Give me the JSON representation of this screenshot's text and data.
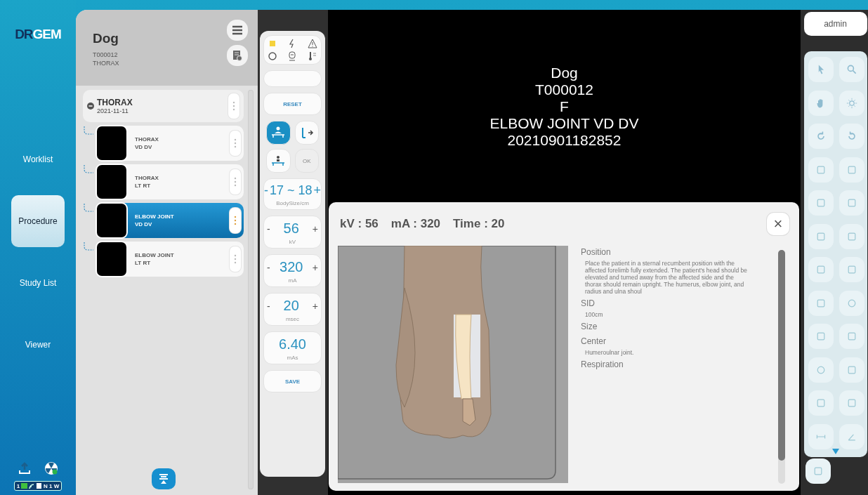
{
  "logo": {
    "parts": [
      "DR",
      "GEM"
    ]
  },
  "nav": [
    {
      "label": "Worklist",
      "selected": false
    },
    {
      "label": "Procedure",
      "selected": true
    },
    {
      "label": "Study List",
      "selected": false
    },
    {
      "label": "Viewer",
      "selected": false
    }
  ],
  "status": {
    "slot": "1",
    "mode": "N 1 W"
  },
  "patient": {
    "name": "Dog",
    "id": "T000012",
    "study": "THORAX"
  },
  "study_group": {
    "title": "THORAX",
    "date": "2021-11-11",
    "expanded": true
  },
  "procedures": [
    {
      "lines": [
        "THORAX",
        "VD DV"
      ],
      "selected": false
    },
    {
      "lines": [
        "THORAX",
        "LT RT"
      ],
      "selected": false
    },
    {
      "lines": [
        "ELBOW JOINT",
        "VD DV"
      ],
      "selected": true
    },
    {
      "lines": [
        "ELBOW JOINT",
        "LT RT"
      ],
      "selected": false
    }
  ],
  "controls": {
    "reset": "RESET",
    "positions": [
      {
        "kind": "supine",
        "selected": true,
        "disabled": false
      },
      {
        "kind": "lateral",
        "selected": false,
        "disabled": false
      },
      {
        "kind": "table",
        "selected": false,
        "disabled": false
      },
      {
        "kind": "text",
        "label": "OK",
        "selected": false,
        "disabled": true
      }
    ],
    "body_size": {
      "minus": "-",
      "value": "17 ~ 18",
      "plus": "+",
      "unit": "BodySize/cm"
    },
    "params": [
      {
        "value": "56",
        "unit": "kV",
        "minus": "-",
        "plus": "+"
      },
      {
        "value": "320",
        "unit": "mA",
        "minus": "-",
        "plus": "+"
      },
      {
        "value": "20",
        "unit": "msec",
        "minus": "-",
        "plus": "+"
      }
    ],
    "mas": {
      "value": "6.40",
      "unit": "mAs"
    },
    "save": "SAVE"
  },
  "viewer": {
    "lines": [
      "Dog",
      "T000012",
      "F",
      "ELBOW JOINT VD DV",
      "20210901182852"
    ]
  },
  "user": "admin",
  "dialog": {
    "readings": [
      "kV : 56",
      "mA : 320",
      "Time : 20"
    ],
    "close": "×",
    "sections": [
      {
        "heading": "Position",
        "text": "Place the patient in a sternal recumbent position with the affected forelimb fully extended. The patient's head should be elevated and turned away from the affected side and the thorax should remain upright. The humerus, elbow joint, and radius and ulna shoul"
      },
      {
        "heading": "SID",
        "text": "100cm"
      },
      {
        "heading": "Size"
      },
      {
        "heading": "Center",
        "text": "Humeroulnar joint."
      },
      {
        "heading": "Respiration"
      }
    ]
  }
}
